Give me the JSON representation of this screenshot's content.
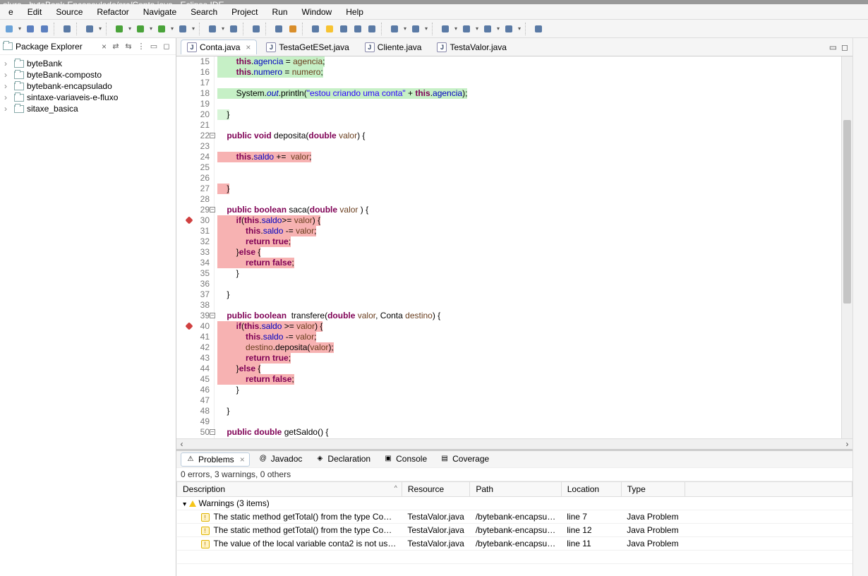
{
  "window_title": "alura - byteBank-Encapsulado/src/Conta.java - Eclipse IDE",
  "menu": [
    "e",
    "Edit",
    "Source",
    "Refactor",
    "Navigate",
    "Search",
    "Project",
    "Run",
    "Window",
    "Help"
  ],
  "package_explorer": {
    "title": "Package Explorer",
    "items": [
      "byteBank",
      "byteBank-composto",
      "bytebank-encapsulado",
      "sintaxe-variaveis-e-fluxo",
      "sitaxe_basica"
    ]
  },
  "editor_tabs": [
    {
      "label": "Conta.java",
      "active": true
    },
    {
      "label": "TestaGetESet.java",
      "active": false
    },
    {
      "label": "Cliente.java",
      "active": false
    },
    {
      "label": "TestaValor.java",
      "active": false
    }
  ],
  "code": {
    "start": 15,
    "lines": [
      {
        "n": 15,
        "hl": "green",
        "html": "        <span class='this'>this</span>.<span class='field'>agencia</span> = <span class='param'>agencia</span>;"
      },
      {
        "n": 16,
        "hl": "green",
        "html": "        <span class='this'>this</span>.<span class='field'>numero</span> = <span class='param'>numero</span>;"
      },
      {
        "n": 17,
        "hl": "",
        "html": ""
      },
      {
        "n": 18,
        "hl": "green",
        "html": "        System.<span class='it'>out</span>.println(<span class='str'>\"estou criando uma conta\"</span> + <span class='this'>this</span>.<span class='field'>agencia</span>);"
      },
      {
        "n": 19,
        "hl": "",
        "html": ""
      },
      {
        "n": 20,
        "hl": "green-soft",
        "html": "    }"
      },
      {
        "n": 21,
        "hl": "",
        "html": ""
      },
      {
        "n": 22,
        "hl": "",
        "fold": true,
        "html": "    <span class='kw'>public</span> <span class='kw'>void</span> deposita(<span class='kw'>double</span> <span class='param'>valor</span>) {"
      },
      {
        "n": 23,
        "hl": "",
        "html": ""
      },
      {
        "n": 24,
        "hl": "pink",
        "html": "        <span class='this'>this</span>.<span class='field'>saldo</span> +=  <span class='param'>valor</span>;"
      },
      {
        "n": 25,
        "hl": "",
        "html": ""
      },
      {
        "n": 26,
        "hl": "",
        "html": ""
      },
      {
        "n": 27,
        "hl": "pink",
        "html": "    }"
      },
      {
        "n": 28,
        "hl": "",
        "html": ""
      },
      {
        "n": 29,
        "hl": "",
        "fold": true,
        "html": "    <span class='kw'>public</span> <span class='kw'>boolean</span> saca(<span class='kw'>double</span> <span class='param'>valor</span> ) {"
      },
      {
        "n": 30,
        "hl": "pink",
        "bp": true,
        "html": "        <span class='kw'>if</span>(<span class='this'>this</span>.<span class='field'>saldo</span>>= <span class='param'>valor</span>) {"
      },
      {
        "n": 31,
        "hl": "pink",
        "html": "            <span class='this'>this</span>.<span class='field'>saldo</span> -= <span class='param'>valor</span>;"
      },
      {
        "n": 32,
        "hl": "pink",
        "html": "            <span class='kw'>return</span> <span class='kw'>true</span>;"
      },
      {
        "n": 33,
        "hl": "pink",
        "html": "        }<span class='kw'>else</span> {"
      },
      {
        "n": 34,
        "hl": "pink",
        "html": "            <span class='kw'>return</span> <span class='kw'>false</span>;"
      },
      {
        "n": 35,
        "hl": "",
        "html": "        }"
      },
      {
        "n": 36,
        "hl": "",
        "html": ""
      },
      {
        "n": 37,
        "hl": "",
        "html": "    }"
      },
      {
        "n": 38,
        "hl": "",
        "html": ""
      },
      {
        "n": 39,
        "hl": "",
        "fold": true,
        "html": "    <span class='kw'>public</span> <span class='kw'>boolean</span>  transfere(<span class='kw'>double</span> <span class='param'>valor</span>, Conta <span class='param'>destino</span>) {"
      },
      {
        "n": 40,
        "hl": "pink",
        "bp": true,
        "html": "        <span class='kw'>if</span>(<span class='this'>this</span>.<span class='field'>saldo</span> >= <span class='param'>valor</span>) {"
      },
      {
        "n": 41,
        "hl": "pink",
        "html": "            <span class='this'>this</span>.<span class='field'>saldo</span> -= <span class='param'>valor</span>;"
      },
      {
        "n": 42,
        "hl": "pink",
        "html": "            <span class='param'>destino</span>.deposita(<span class='param'>valor</span>);"
      },
      {
        "n": 43,
        "hl": "pink",
        "html": "            <span class='kw'>return</span> <span class='kw'>true</span>;"
      },
      {
        "n": 44,
        "hl": "pink",
        "html": "        }<span class='kw'>else</span> {"
      },
      {
        "n": 45,
        "hl": "pink",
        "html": "            <span class='kw'>return</span> <span class='kw'>false</span>;"
      },
      {
        "n": 46,
        "hl": "",
        "html": "        }"
      },
      {
        "n": 47,
        "hl": "",
        "html": ""
      },
      {
        "n": 48,
        "hl": "",
        "html": "    }"
      },
      {
        "n": 49,
        "hl": "",
        "html": ""
      },
      {
        "n": 50,
        "hl": "",
        "fold": true,
        "html": "    <span class='kw'>public</span> <span class='kw'>double</span> getSaldo() {"
      }
    ]
  },
  "bottom": {
    "tabs": [
      "Problems",
      "Javadoc",
      "Declaration",
      "Console",
      "Coverage"
    ],
    "status": "0 errors, 3 warnings, 0 others",
    "columns": [
      "Description",
      "Resource",
      "Path",
      "Location",
      "Type"
    ],
    "group": "Warnings (3 items)",
    "rows": [
      {
        "desc": "The static method getTotal() from the type Co…",
        "res": "TestaValor.java",
        "path": "/bytebank-encapsu…",
        "loc": "line 7",
        "type": "Java Problem"
      },
      {
        "desc": "The static method getTotal() from the type Co…",
        "res": "TestaValor.java",
        "path": "/bytebank-encapsu…",
        "loc": "line 12",
        "type": "Java Problem"
      },
      {
        "desc": "The value of the local variable conta2 is not us…",
        "res": "TestaValor.java",
        "path": "/bytebank-encapsu…",
        "loc": "line 11",
        "type": "Java Problem"
      }
    ]
  },
  "toolbar_icons": [
    "new",
    "save",
    "save-all",
    "sep",
    "terminal",
    "sep",
    "skip-bp",
    "sep",
    "debug",
    "run",
    "coverage",
    "ext-tools",
    "sep",
    "new-pkg",
    "new-class",
    "sep",
    "open-type",
    "sep",
    "search",
    "glasses",
    "sep",
    "toggle",
    "highlight",
    "block",
    "outline",
    "pilcrow",
    "sep",
    "annot-prev",
    "annot-next",
    "sep",
    "back",
    "fwd",
    "back2",
    "fwd2",
    "sep",
    "pin"
  ],
  "tb_colors": {
    "debug": "#4aa33a",
    "run": "#4aa33a",
    "coverage": "#4aa33a",
    "highlight": "#f7c331",
    "glasses": "#d98e2b",
    "new": "#6aa2d8",
    "save": "#5b7fbf",
    "save-all": "#5b7fbf"
  }
}
